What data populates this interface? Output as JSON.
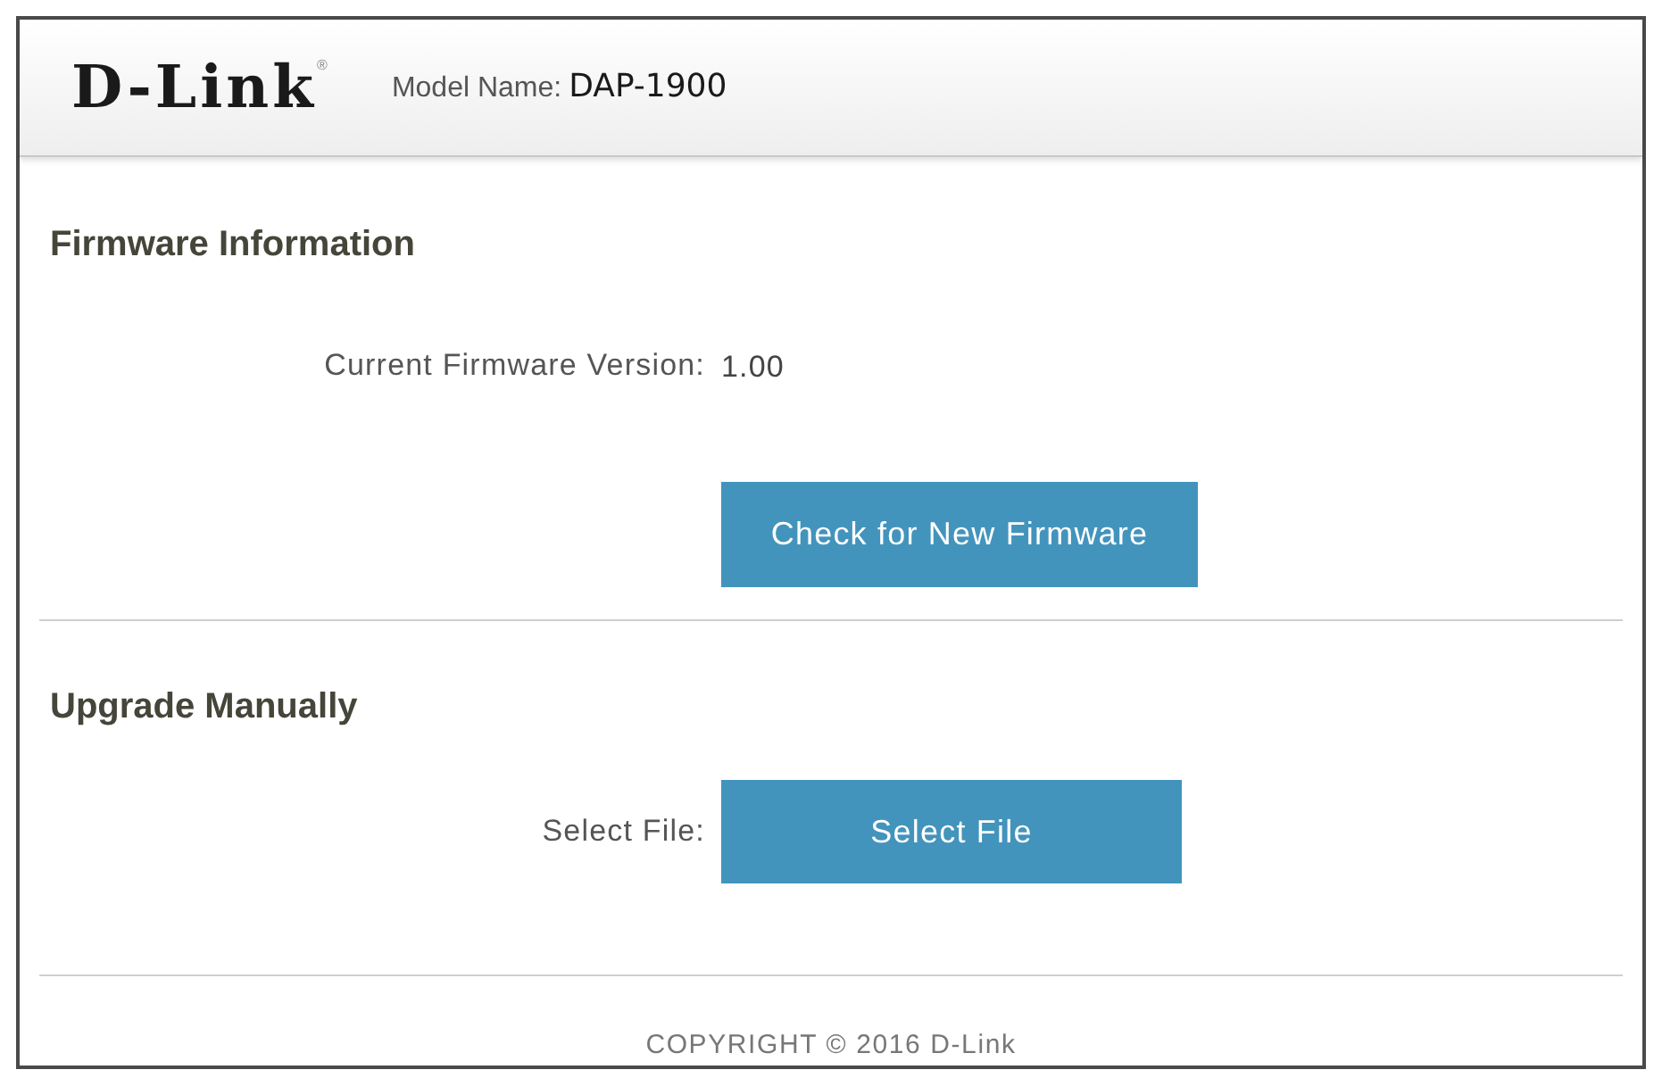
{
  "header": {
    "logo": {
      "text": "D-Link",
      "mark": "®"
    },
    "model_label": "Model Name:",
    "model_value": "DAP-1900"
  },
  "sections": [
    {
      "title": "Firmware Information",
      "rows": [
        {
          "kind": "value",
          "label": "Current Firmware Version:",
          "value": "1.00"
        },
        {
          "kind": "button",
          "button": "Check for New Firmware"
        }
      ]
    },
    {
      "title": "Upgrade Manually",
      "rows": [
        {
          "kind": "file",
          "label": "Select File:",
          "button": "Select File"
        }
      ]
    }
  ],
  "footer": {
    "copyright": "COPYRIGHT © 2016 D-Link"
  }
}
